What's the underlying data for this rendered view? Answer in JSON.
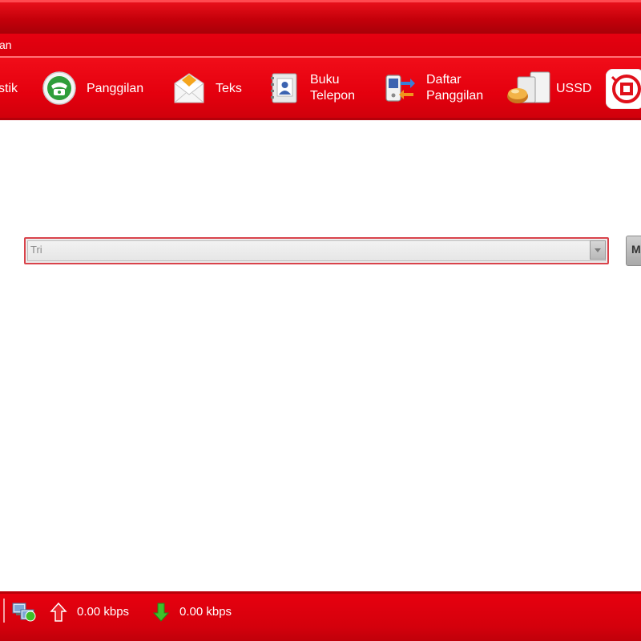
{
  "menu": {
    "items": [
      "an"
    ]
  },
  "toolbar": {
    "items": [
      {
        "label_lines": [
          "stik"
        ],
        "icon": "statistics-icon"
      },
      {
        "label_lines": [
          "Panggilan"
        ],
        "icon": "phone-icon"
      },
      {
        "label_lines": [
          "Teks"
        ],
        "icon": "envelope-icon"
      },
      {
        "label_lines": [
          "Buku",
          "Telepon"
        ],
        "icon": "phonebook-icon"
      },
      {
        "label_lines": [
          "Daftar",
          "Panggilan"
        ],
        "icon": "call-log-icon"
      },
      {
        "label_lines": [
          "USSD"
        ],
        "icon": "ussd-icon"
      },
      {
        "label_lines": [],
        "icon": "network-logo-icon"
      }
    ]
  },
  "content": {
    "network_select": {
      "value": "Tri"
    },
    "side_button_label": "M",
    "colon": ":"
  },
  "status": {
    "upload_speed": "0.00 kbps",
    "download_speed": "0.00 kbps"
  },
  "colors": {
    "brand_red": "#e3000f",
    "upload_arrow": "#e9262d",
    "download_arrow": "#3fbf2a"
  }
}
